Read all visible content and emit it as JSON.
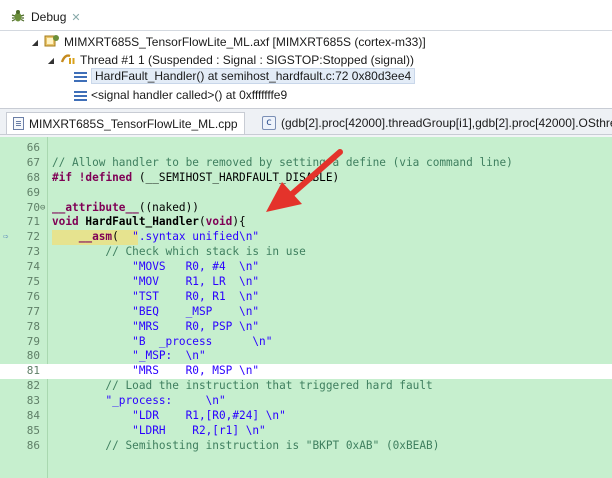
{
  "debug": {
    "tab_label": "Debug",
    "close_glyph": "✕",
    "process": "MIMXRT685S_TensorFlowLite_ML.axf [MIMXRT685S (cortex-m33)]",
    "thread": "Thread #1 1 (Suspended : Signal : SIGSTOP:Stopped (signal))",
    "frames": [
      "HardFault_Handler() at semihost_hardfault.c:72 0x80d3ee4",
      "<signal handler called>() at 0xfffffffe9"
    ]
  },
  "editor": {
    "tabs": [
      {
        "icon": "file-icon",
        "label": "MIMXRT685S_TensorFlowLite_ML.cpp"
      },
      {
        "icon": "c-source-icon",
        "label": "(gdb[2].proc[42000].threadGroup[i1],gdb[2].proc[42000].OSthre"
      }
    ],
    "lines": [
      {
        "num": "66",
        "text": ""
      },
      {
        "num": "67",
        "text": "// Allow handler to be removed by setting a define (via command line)"
      },
      {
        "num": "68",
        "text": "#if !defined (__SEMIHOST_HARDFAULT_DISABLE)"
      },
      {
        "num": "69",
        "text": ""
      },
      {
        "num": "70",
        "text": "__attribute__((naked))"
      },
      {
        "num": "71",
        "text": "void HardFault_Handler(void){"
      },
      {
        "num": "72",
        "text": "    __asm(  \".syntax unified\\n\""
      },
      {
        "num": "73",
        "text": "        // Check which stack is in use"
      },
      {
        "num": "74",
        "text": "            \"MOVS   R0, #4  \\n\""
      },
      {
        "num": "75",
        "text": "            \"MOV    R1, LR  \\n\""
      },
      {
        "num": "76",
        "text": "            \"TST    R0, R1  \\n\""
      },
      {
        "num": "77",
        "text": "            \"BEQ    _MSP    \\n\""
      },
      {
        "num": "78",
        "text": "            \"MRS    R0, PSP \\n\""
      },
      {
        "num": "79",
        "text": "            \"B  _process      \\n\""
      },
      {
        "num": "80",
        "text": "            \"_MSP:  \\n\""
      },
      {
        "num": "81",
        "text": "            \"MRS    R0, MSP \\n\""
      },
      {
        "num": "82",
        "text": "        // Load the instruction that triggered hard fault"
      },
      {
        "num": "83",
        "text": "        \"_process:     \\n\""
      },
      {
        "num": "84",
        "text": "            \"LDR    R1,[R0,#24] \\n\""
      },
      {
        "num": "85",
        "text": "            \"LDRH    R2,[r1] \\n\""
      },
      {
        "num": "86",
        "text": "        // Semihosting instruction is \"BKPT 0xAB\" (0xBEAB)"
      }
    ]
  },
  "colors": {
    "code_background": "#c6efce",
    "current_line": "#e6e38f",
    "arrow": "#e4332b",
    "keyword": "#7f0055",
    "comment": "#3f7f5f",
    "string": "#2a00ff"
  }
}
